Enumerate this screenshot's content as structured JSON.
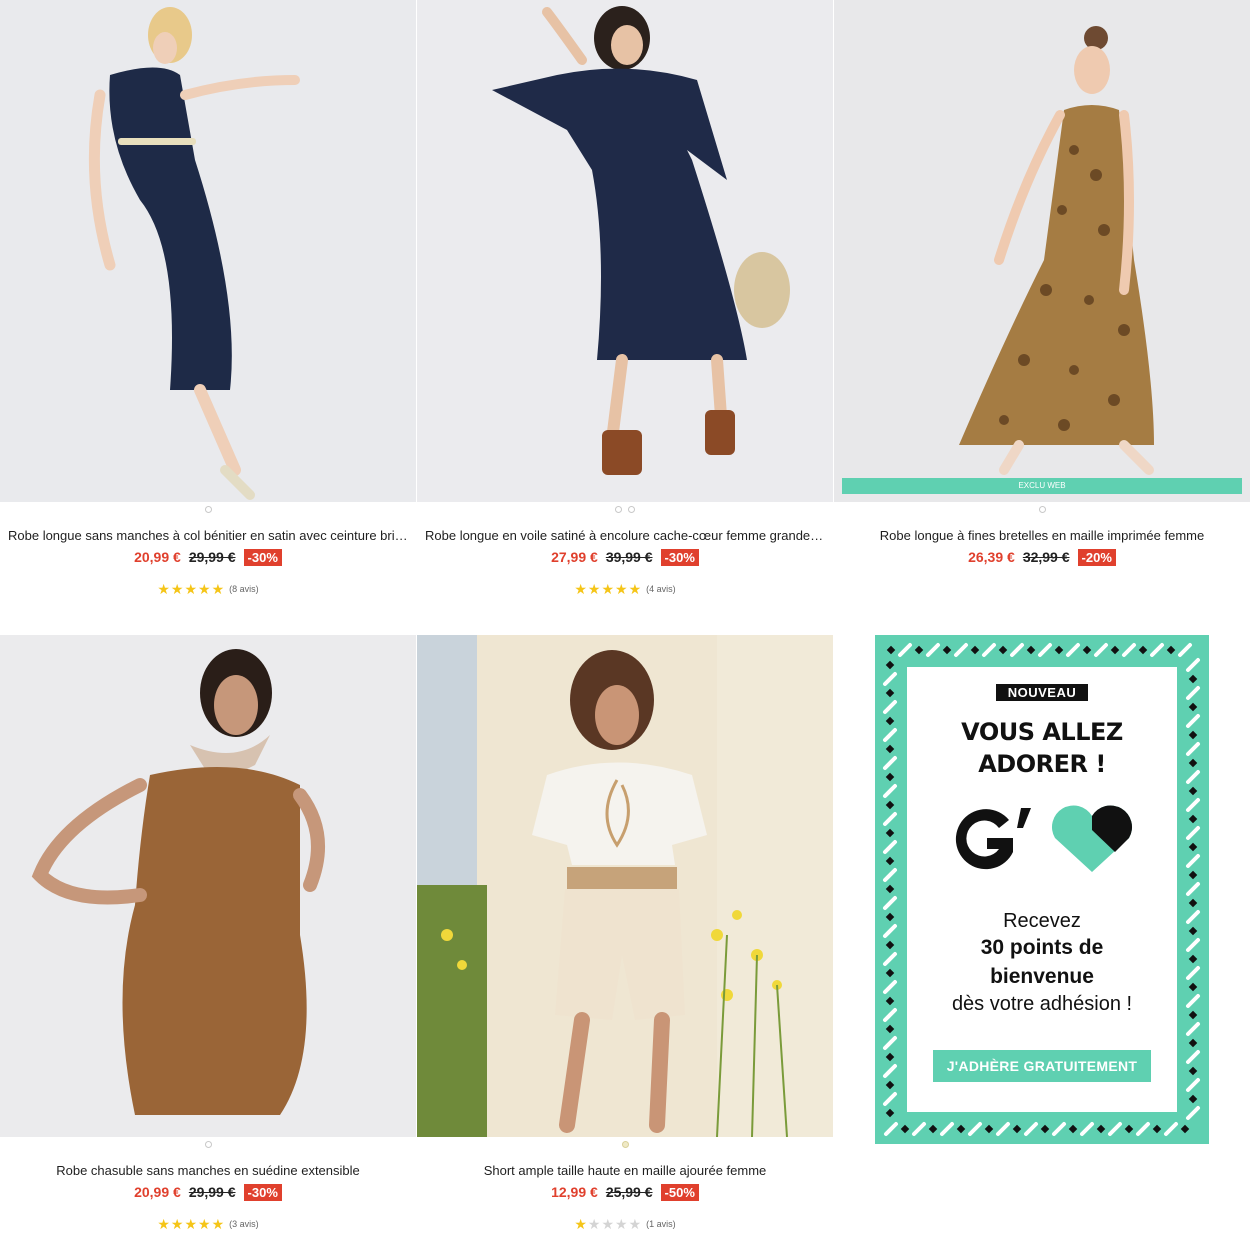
{
  "products": [
    {
      "title": "Robe longue sans manches à col bénitier en satin avec ceinture brillante",
      "price": "20,99 €",
      "old_price": "29,99 €",
      "discount": "-30%",
      "stars": "★★★★★",
      "rating_value": 4.5,
      "reviews": "(8 avis)",
      "dot_count": 1,
      "image": "woman-navy-satin-dress"
    },
    {
      "title": "Robe longue en voile satiné à encolure cache-cœur femme grande taille",
      "price": "27,99 €",
      "old_price": "39,99 €",
      "discount": "-30%",
      "stars": "★★★★★",
      "rating_value": 5,
      "reviews": "(4 avis)",
      "dot_count": 2,
      "image": "woman-navy-wrap-dress-straw-bag"
    },
    {
      "title": "Robe longue à fines bretelles en maille imprimée femme",
      "price": "26,39 €",
      "old_price": "32,99 €",
      "discount": "-20%",
      "badge": "EXCLU WEB",
      "dot_count": 1,
      "image": "woman-leopard-print-dress"
    },
    {
      "title": "Robe chasuble sans manches en suédine extensible",
      "price": "20,99 €",
      "old_price": "29,99 €",
      "discount": "-30%",
      "stars": "★★★★★",
      "rating_value": 5,
      "reviews": "(3 avis)",
      "dot_count": 1,
      "image": "woman-camel-suede-dress-scarf"
    },
    {
      "title": "Short ample taille haute en maille ajourée femme",
      "price": "12,99 €",
      "old_price": "25,99 €",
      "discount": "-50%",
      "stars_on": "★",
      "stars_off": "★★★★",
      "rating_value": 1,
      "reviews": "(1 avis)",
      "dot_count": 1,
      "image": "woman-crochet-shorts-flowers"
    }
  ],
  "promo": {
    "badge": "NOUVEAU",
    "headline_1": "VOUS ALLEZ",
    "headline_2": "ADORER !",
    "logo": "G'-heart-logo",
    "line1": "Recevez",
    "line2": "30 points de",
    "line3": "bienvenue",
    "line4": "dès votre adhésion !",
    "cta": "J'ADHÈRE GRATUITEMENT"
  },
  "colors": {
    "accent_mint": "#5fd0b1",
    "sale_red": "#e0402d",
    "star_yellow": "#f5c518"
  }
}
